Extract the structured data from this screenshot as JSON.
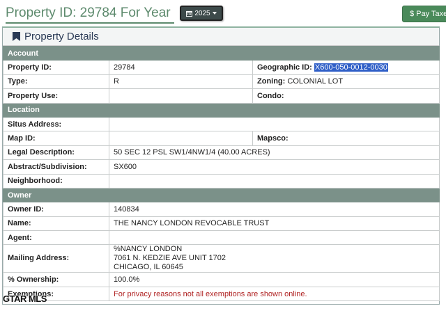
{
  "header": {
    "title": "Property ID: 29784 For Year",
    "year_label": "2025",
    "pay_taxes_label": "$ Pay Taxe"
  },
  "panel": {
    "heading": "Property Details"
  },
  "sections": {
    "account": "Account",
    "location": "Location",
    "owner": "Owner"
  },
  "account": {
    "property_id_label": "Property ID:",
    "property_id": "29784",
    "geographic_id_label": "Geographic ID:",
    "geographic_id": "X600-050-0012-0030",
    "type_label": "Type:",
    "type": "R",
    "zoning_label": "Zoning:",
    "zoning": "COLONIAL LOT",
    "property_use_label": "Property Use:",
    "property_use": "",
    "condo_label": "Condo:",
    "condo": ""
  },
  "location": {
    "situs_label": "Situs Address:",
    "situs": "",
    "map_id_label": "Map ID:",
    "map_id": "",
    "mapsco_label": "Mapsco:",
    "mapsco": "",
    "legal_label": "Legal Description:",
    "legal": "50 SEC 12 PSL SW1/4NW1/4 (40.00 ACRES)",
    "abstract_label": "Abstract/Subdivision:",
    "abstract": "SX600",
    "neighborhood_label": "Neighborhood:",
    "neighborhood": ""
  },
  "owner": {
    "owner_id_label": "Owner ID:",
    "owner_id": "140834",
    "name_label": "Name:",
    "name": "THE NANCY LONDON REVOCABLE TRUST",
    "agent_label": "Agent:",
    "agent": "",
    "mailing_label": "Mailing Address:",
    "mailing_line1": "%NANCY LONDON",
    "mailing_line2": "7061 N. KEDZIE AVE UNIT 1702",
    "mailing_line3": "CHICAGO, IL 60645",
    "ownership_label": "% Ownership:",
    "ownership": "100.0%",
    "exemptions_label": "Exemptions:",
    "exemptions": "For privacy reasons not all exemptions are shown online."
  },
  "watermark": "GTAR MLS",
  "colors": {
    "title_green": "#5d8a6d",
    "section_gray": "#7b9189",
    "highlight_blue": "#2f5fc7",
    "privacy_red": "#b02222"
  }
}
